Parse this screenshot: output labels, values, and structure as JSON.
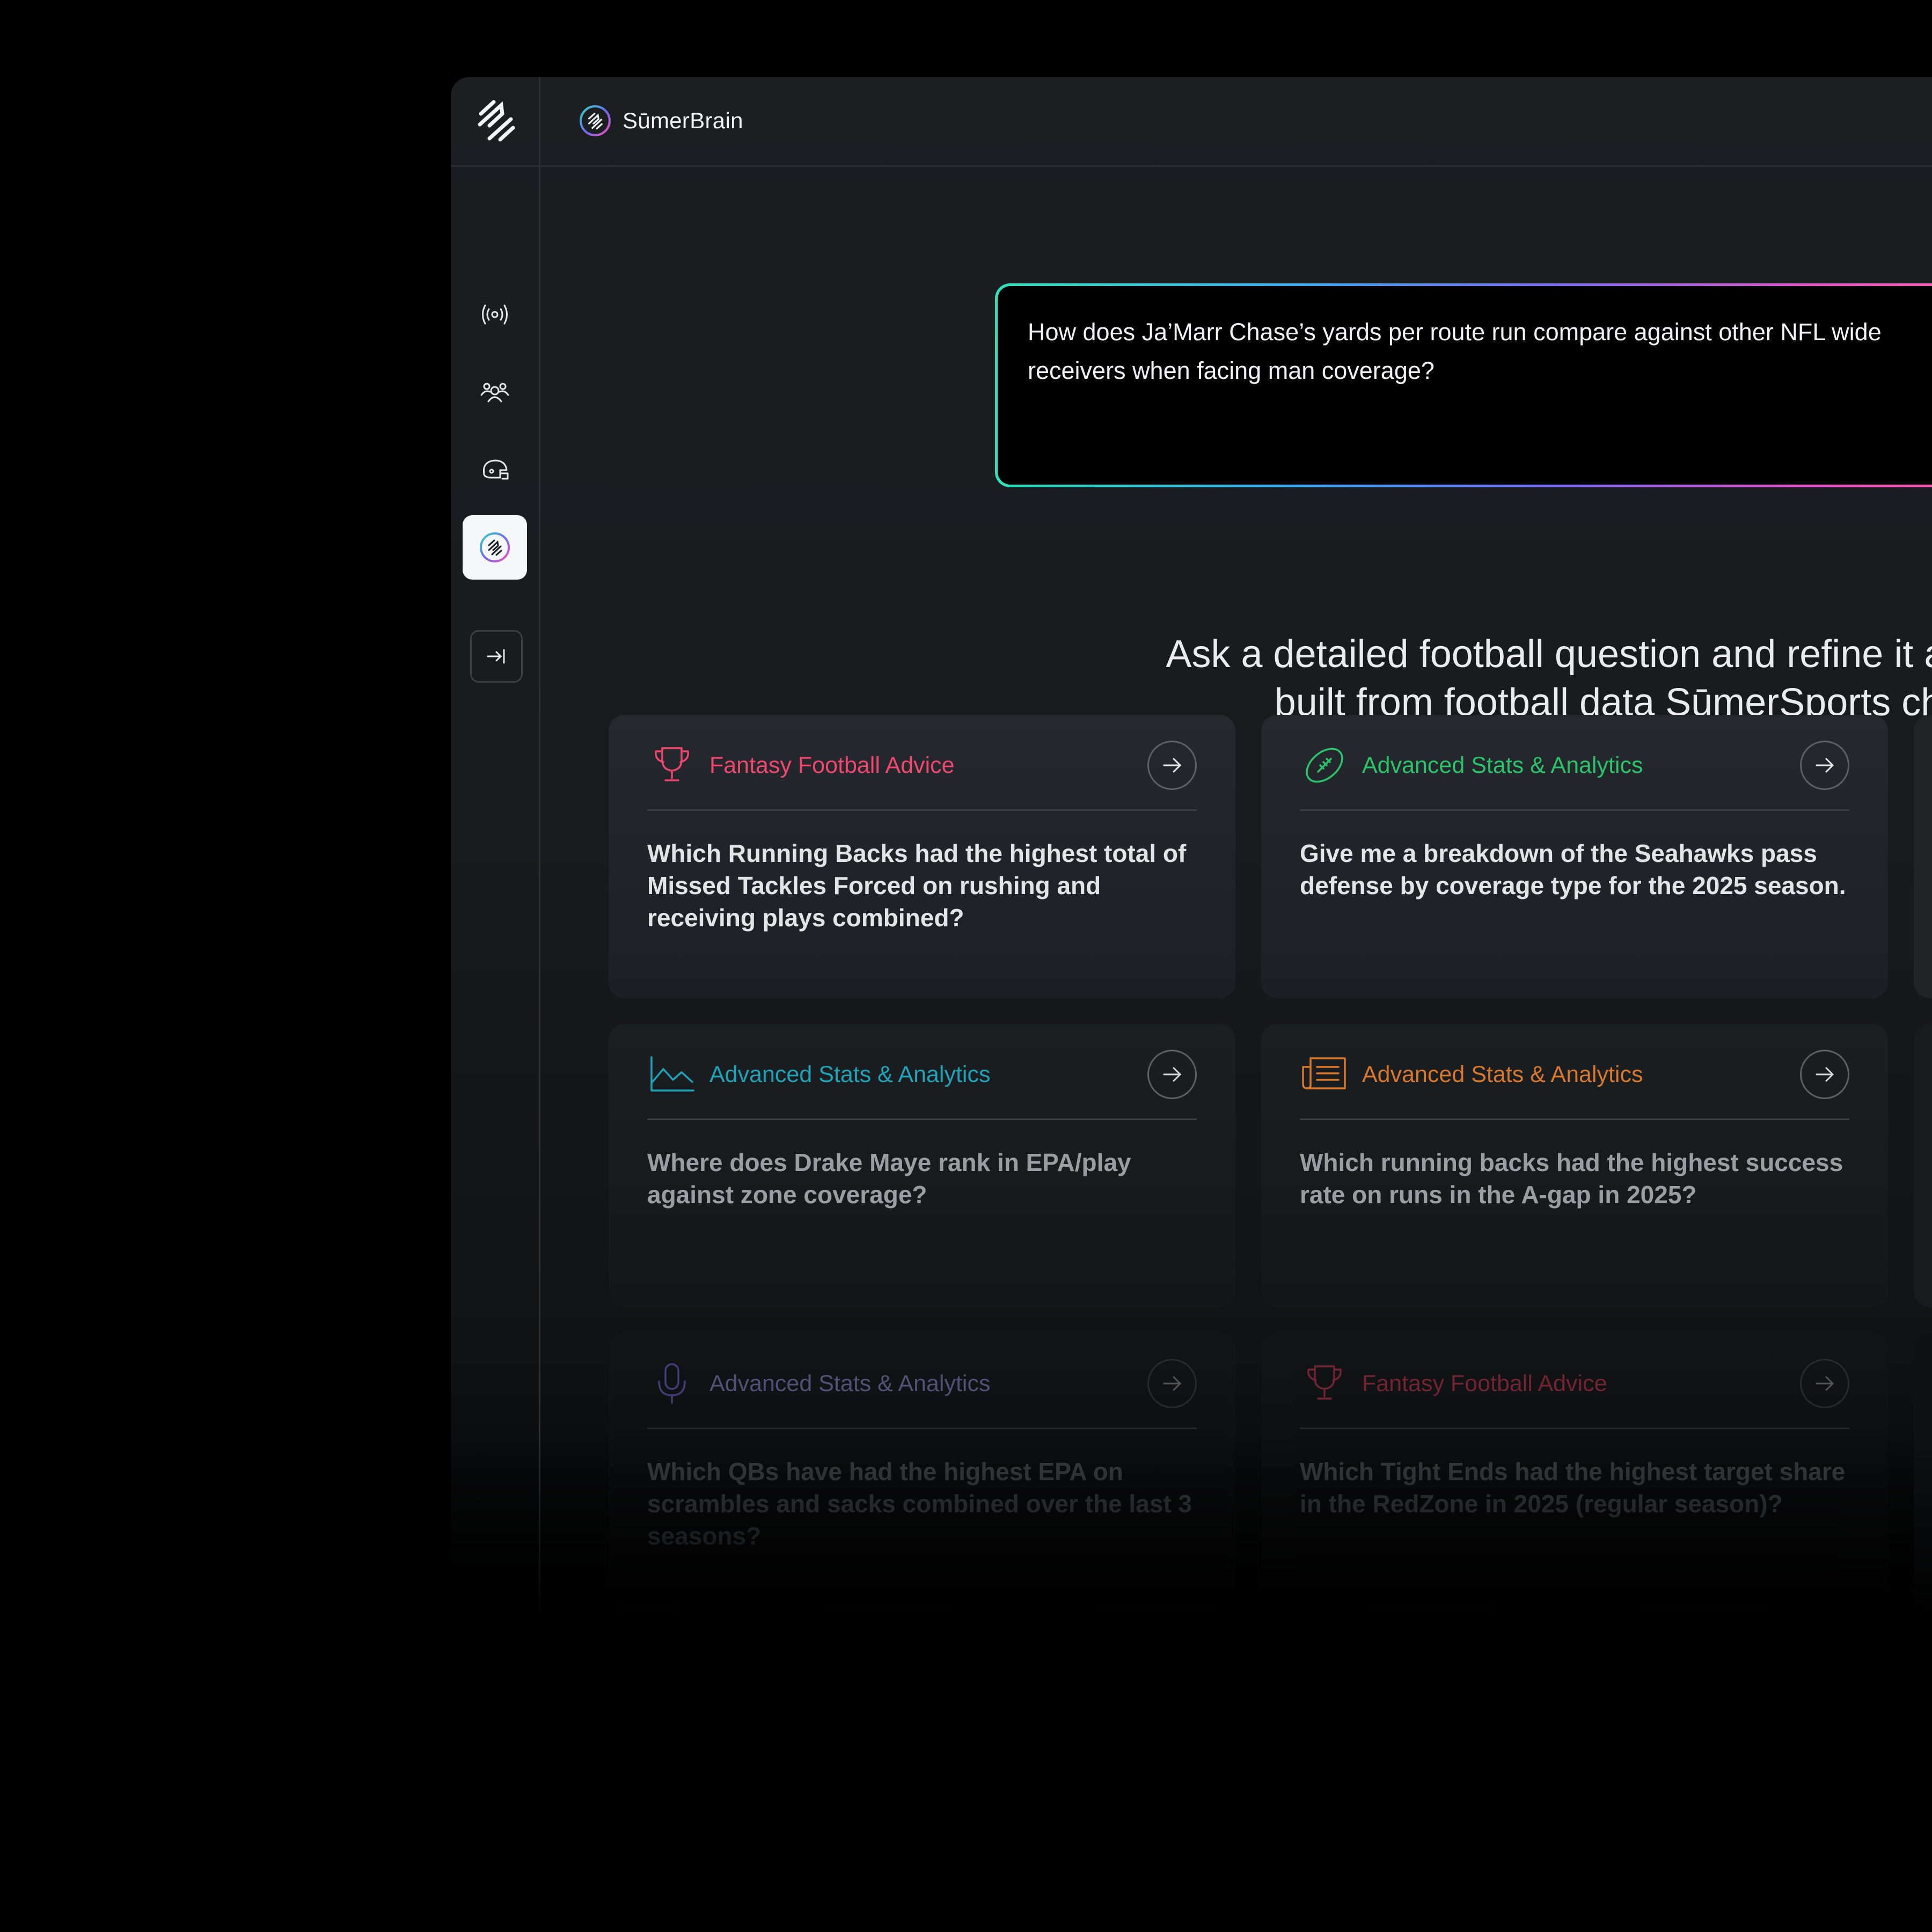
{
  "app": {
    "brand_name": "SūmerBrain",
    "sidebar": {
      "items": [
        {
          "icon": "broadcast-icon"
        },
        {
          "icon": "users-icon"
        },
        {
          "icon": "helmet-icon"
        },
        {
          "icon": "sumerbrain-icon",
          "active": true
        }
      ],
      "collapse_icon": "expand-sidebar-icon"
    },
    "prompt": {
      "text": "How does Ja’Marr Chase’s yards per route run compare against other NFL wide receivers when facing man coverage?"
    },
    "tagline": {
      "line1": "Ask a detailed football question and refine it as you go.",
      "line2": "built from football data SūmerSports charts it"
    },
    "cards": [
      {
        "category": "Fantasy Football Advice",
        "icon": "trophy-icon",
        "color": "#f0476f",
        "question": "Which Running Backs had the highest total of Missed Tackles Forced on rushing and receiving plays combined?"
      },
      {
        "category": "Advanced Stats & Analytics",
        "icon": "football-icon",
        "color": "#2bc46b",
        "question": "Give me a breakdown of the Seahawks pass defense by coverage type for the 2025 season."
      },
      {
        "category": "Advanced Stats & Analytics",
        "icon": "line-chart-icon",
        "color": "#1fa3b8",
        "question": "Where does Drake Maye rank in EPA/play against zone coverage?"
      },
      {
        "category": "Advanced Stats & Analytics",
        "icon": "news-icon",
        "color": "#d8782c",
        "question": "Which running backs had the highest success rate on runs in the A-gap in 2025?"
      },
      {
        "category": "Advanced Stats & Analytics",
        "icon": "microphone-icon",
        "color": "#6b63c9",
        "question": "Which QBs have had the highest EPA on scrambles and sacks combined over the last 3 seasons?"
      },
      {
        "category": "Fantasy Football Advice",
        "icon": "trophy-icon",
        "color": "#c2374f",
        "question": "Which Tight Ends had the highest target share in the RedZone in 2025 (regular season)?"
      }
    ]
  }
}
